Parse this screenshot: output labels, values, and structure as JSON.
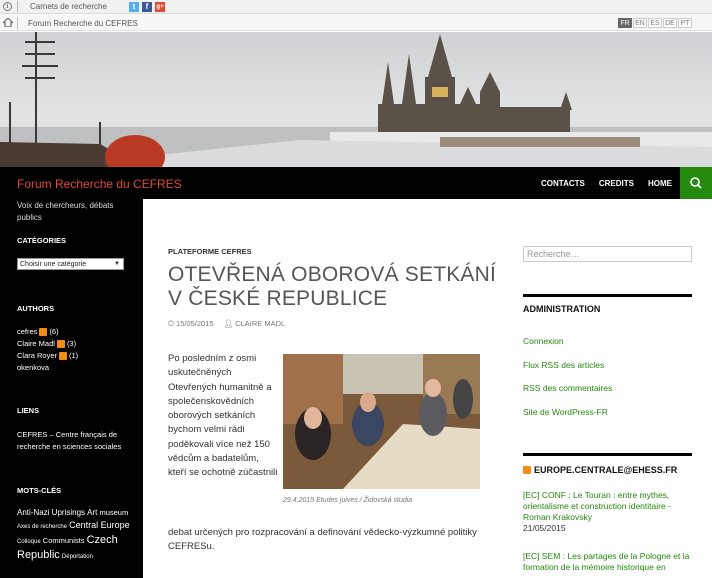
{
  "topbar": {
    "carnets": "Carnets de recherche",
    "breadcrumb": "Forum Recherche du CEFRES",
    "languages": [
      "FR",
      "EN",
      "ES",
      "DE",
      "PT"
    ],
    "active_language": "FR"
  },
  "header": {
    "site_title": "Forum Recherche du CEFRES",
    "nav": [
      "CONTACTS",
      "CREDITS",
      "HOME"
    ]
  },
  "sidebar": {
    "description": "Voix de chercheurs, débats publics",
    "categories_title": "CATÉGORIES",
    "categories_select": "Choisir une catégorie",
    "authors_title": "AUTHORS",
    "authors": [
      {
        "name": "cefres",
        "count": "(6)"
      },
      {
        "name": "Claire Madl",
        "count": "(3)"
      },
      {
        "name": "Clara Royer",
        "count": "(1)"
      },
      {
        "name": "okenkova",
        "count": ""
      }
    ],
    "links_title": "LIENS",
    "link": "CEFRES – Centre français de recherche en sciences sociales",
    "tags_title": "MOTS-CLÉS",
    "tags": [
      "Anti-Nazi Uprisings",
      "Art",
      "museum",
      "Axes de recherche",
      "Central Europe",
      "Colloque",
      "Communists",
      "Czech",
      "Republic",
      "Déportation"
    ]
  },
  "post": {
    "category": "PLATEFORME CEFRES",
    "title": "OTEVŘENÁ OBOROVÁ SETKÁNÍ V ČESKÉ REPUBLICE",
    "date": "15/05/2015",
    "author": "CLAIRE MADL",
    "text": "Po posledním z osmi uskutečněných Otevřených humanitně a společenskovědních oborových setkáních bychom velmi rádi poděkovali více než 150 vědcům a badatelům, kteří se ochotně zúčastnili",
    "text2": "debat určených pro rozpracování a definování vědecko-výzkumné politiky CEFRESu.",
    "caption": "29.4.2015 Etudes juives / Židovská studia"
  },
  "widgets": {
    "search_placeholder": "Recherche…",
    "admin_title": "ADMINISTRATION",
    "admin_links": [
      "Connexion",
      "Flux RSS des articles",
      "RSS des commentaires",
      "Site de WordPress-FR"
    ],
    "feed_title": "EUROPE.CENTRALE@EHESS.FR",
    "feed": [
      {
        "title": "[EC] CONF : Le Touran : entre mythes, orientalisme et construction identitaire - Roman Krakovsky",
        "date": "21/05/2015"
      },
      {
        "title": "[EC] SEM : Les partages de la Pologne et la formation de la mémoire historique en",
        "date": ""
      }
    ]
  },
  "colors": {
    "accent": "#24890d",
    "title_red": "#e2473b",
    "rss_orange": "#f28c1c"
  }
}
